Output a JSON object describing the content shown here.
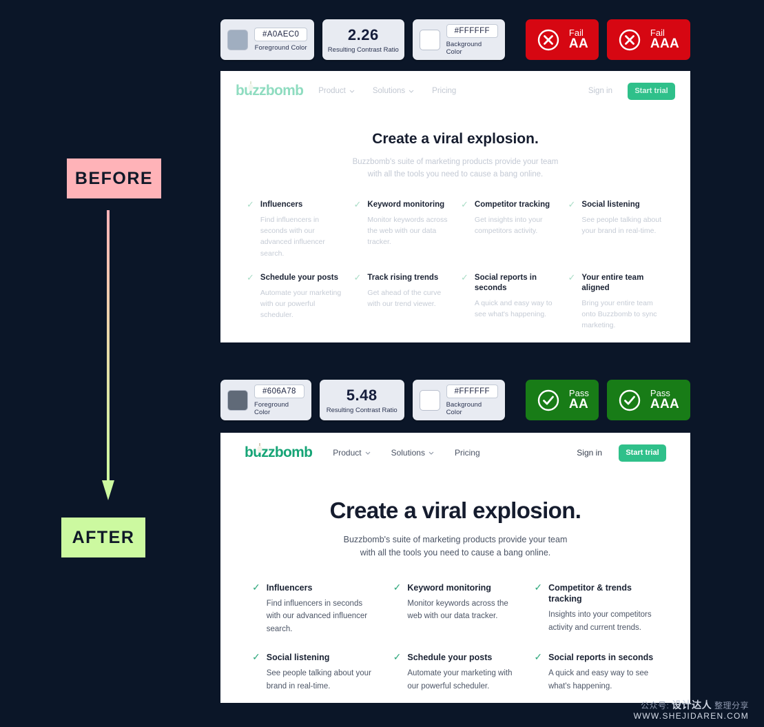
{
  "annotations": {
    "before_label": "BEFORE",
    "after_label": "AFTER",
    "arrow_from_color": "#ffb3b8",
    "arrow_to_color": "#ccf9a0"
  },
  "before": {
    "contrast": {
      "foreground_hex": "#A0AEC0",
      "foreground_caption": "Foreground Color",
      "foreground_swatch_color": "#A0AEC0",
      "ratio_value": "2.26",
      "ratio_caption": "Resulting Contrast Ratio",
      "background_hex": "#FFFFFF",
      "background_caption": "Background Color",
      "background_swatch_color": "#FFFFFF",
      "badges": [
        {
          "status": "Fail",
          "level": "AA",
          "result": "fail",
          "color": "#d60712"
        },
        {
          "status": "Fail",
          "level": "AAA",
          "result": "fail",
          "color": "#d60712"
        }
      ]
    },
    "site": {
      "logo_text": "buzzbomb",
      "logo_color": "#8FDCC0",
      "nav_links": [
        {
          "label": "Product",
          "has_caret": true
        },
        {
          "label": "Solutions",
          "has_caret": true
        },
        {
          "label": "Pricing",
          "has_caret": false
        }
      ],
      "signin_label": "Sign in",
      "trial_label": "Start trial",
      "hero_title": "Create a viral explosion.",
      "hero_sub_line1": "Buzzbomb's suite of marketing products provide your team",
      "hero_sub_line2": "with all the tools you need to cause a bang online.",
      "features": [
        {
          "title": "Influencers",
          "desc": "Find influencers in seconds with our advanced influencer search."
        },
        {
          "title": "Keyword monitoring",
          "desc": "Monitor keywords across the web with our data tracker."
        },
        {
          "title": "Competitor tracking",
          "desc": "Get insights into your competitors activity."
        },
        {
          "title": "Social listening",
          "desc": "See people talking about your brand in real-time."
        },
        {
          "title": "Schedule your posts",
          "desc": "Automate your marketing with our powerful scheduler."
        },
        {
          "title": "Track rising trends",
          "desc": "Get ahead of the curve with our trend viewer."
        },
        {
          "title": "Social reports in seconds",
          "desc": "A quick and easy way to see what's happening."
        },
        {
          "title": "Your entire team aligned",
          "desc": "Bring your entire team onto Buzzbomb to sync marketing."
        }
      ]
    }
  },
  "after": {
    "contrast": {
      "foreground_hex": "#606A78",
      "foreground_caption": "Foreground Color",
      "foreground_swatch_color": "#606A78",
      "ratio_value": "5.48",
      "ratio_caption": "Resulting Contrast Ratio",
      "background_hex": "#FFFFFF",
      "background_caption": "Background Color",
      "background_swatch_color": "#FFFFFF",
      "badges": [
        {
          "status": "Pass",
          "level": "AA",
          "result": "pass",
          "color": "#187c17"
        },
        {
          "status": "Pass",
          "level": "AAA",
          "result": "pass",
          "color": "#187c17"
        }
      ]
    },
    "site": {
      "logo_text": "buzzbomb",
      "logo_color": "#16A476",
      "nav_links": [
        {
          "label": "Product",
          "has_caret": true
        },
        {
          "label": "Solutions",
          "has_caret": true
        },
        {
          "label": "Pricing",
          "has_caret": false
        }
      ],
      "signin_label": "Sign in",
      "trial_label": "Start trial",
      "hero_title": "Create a viral explosion.",
      "hero_sub_line1": "Buzzbomb's suite of marketing products provide your team",
      "hero_sub_line2": "with all the tools you need to cause a bang online.",
      "features": [
        {
          "title": "Influencers",
          "desc": "Find influencers in seconds with our advanced influencer search."
        },
        {
          "title": "Keyword monitoring",
          "desc": "Monitor keywords across the web with our data tracker."
        },
        {
          "title": "Competitor & trends tracking",
          "desc": "Insights into your competitors activity and current trends."
        },
        {
          "title": "Social listening",
          "desc": "See people talking about your brand in real-time."
        },
        {
          "title": "Schedule your posts",
          "desc": "Automate your marketing with our powerful scheduler."
        },
        {
          "title": "Social reports in seconds",
          "desc": "A quick and easy way to see what's happening."
        }
      ]
    }
  },
  "watermark": {
    "cn_prefix": "公众号:",
    "cn_brand": "设计达人",
    "cn_suffix": "整理分享",
    "url": "WWW.SHEJIDAREN.COM"
  }
}
